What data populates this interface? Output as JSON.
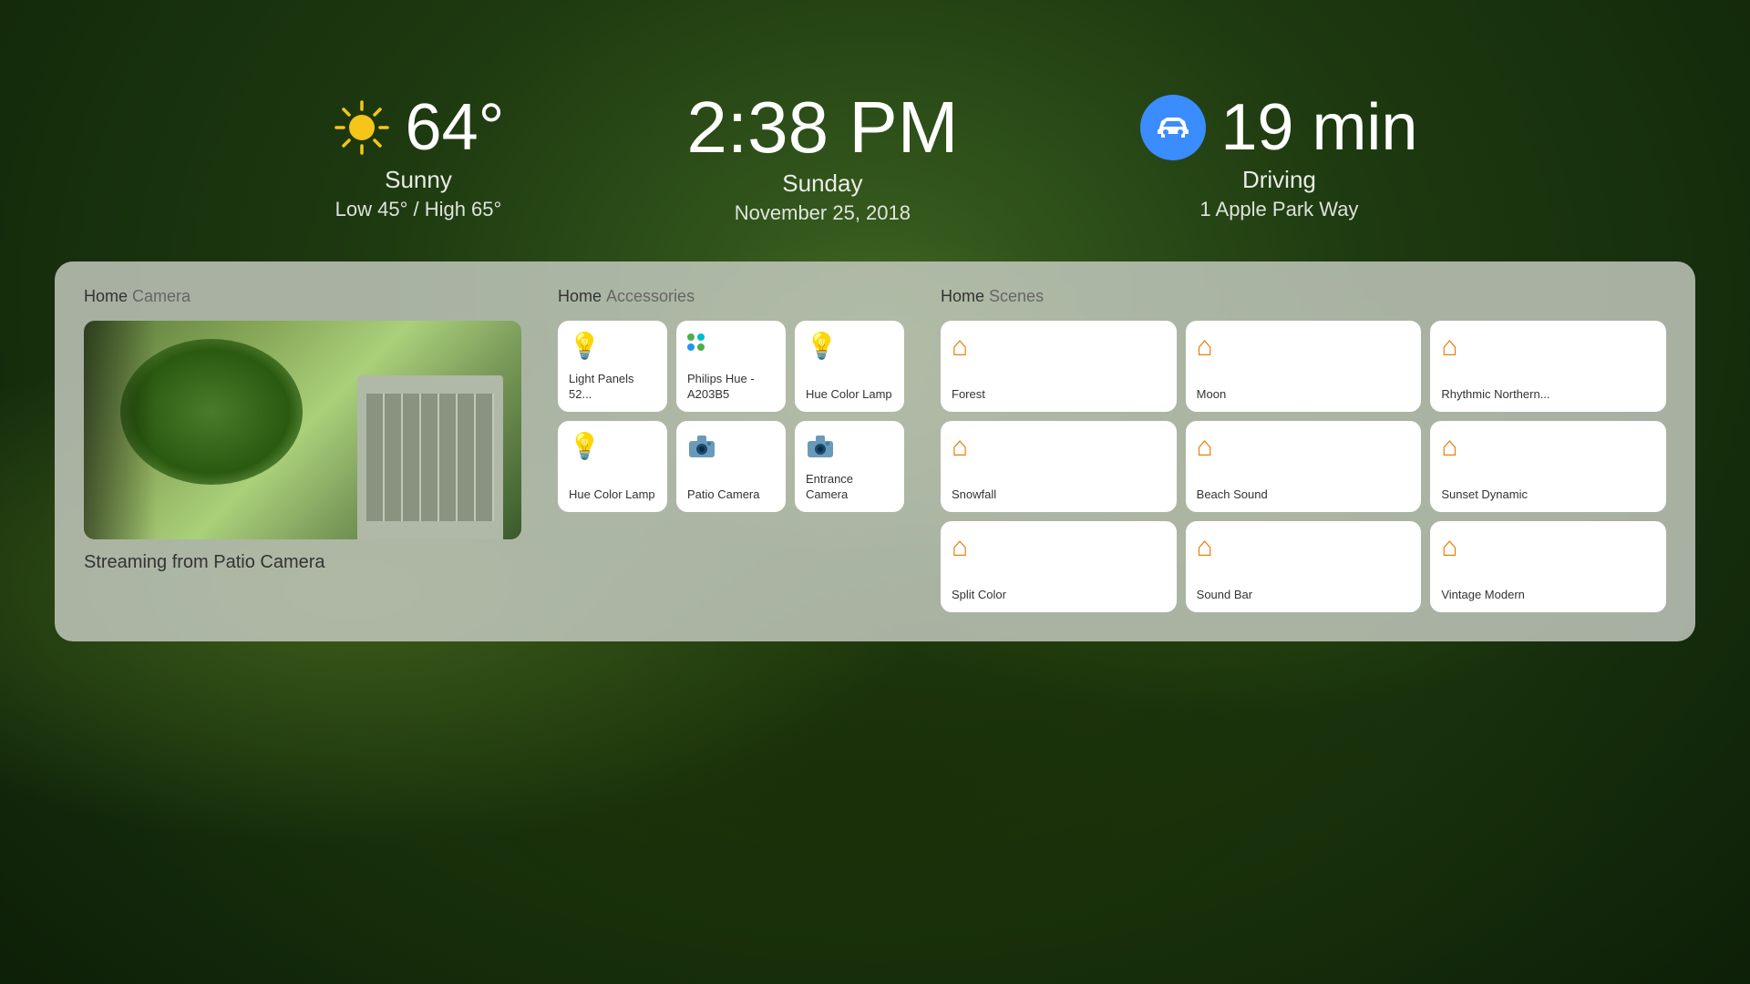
{
  "background": {
    "color": "#2a4a1a"
  },
  "weather": {
    "temperature": "64°",
    "condition": "Sunny",
    "range": "Low 45° / High 65°",
    "icon": "sun-icon"
  },
  "time": {
    "time": "2:38 PM",
    "day": "Sunday",
    "date": "November 25, 2018"
  },
  "maps": {
    "eta": "19 min",
    "mode": "Driving",
    "destination": "1 Apple Park Way",
    "icon": "car-icon"
  },
  "home_panel": {
    "camera_section_title": "Home",
    "camera_section_subtitle": "Camera",
    "camera_label": "Streaming from Patio Camera",
    "accessories_section_title": "Home",
    "accessories_section_subtitle": "Accessories",
    "scenes_section_title": "Home",
    "scenes_section_subtitle": "Scenes",
    "accessories": [
      {
        "id": "light-panels",
        "name": "Light Panels 52...",
        "icon": "💡"
      },
      {
        "id": "philips-hue",
        "name": "Philips Hue - A203B5",
        "icon": "hue"
      },
      {
        "id": "hue-color-lamp-1",
        "name": "Hue Color Lamp",
        "icon": "💡"
      },
      {
        "id": "hue-color-lamp-2",
        "name": "Hue Color Lamp",
        "icon": "💡"
      },
      {
        "id": "patio-camera",
        "name": "Patio Camera",
        "icon": "cam"
      },
      {
        "id": "entrance-camera",
        "name": "Entrance Camera",
        "icon": "cam"
      }
    ],
    "scenes": [
      {
        "id": "forest",
        "name": "Forest"
      },
      {
        "id": "moon",
        "name": "Moon"
      },
      {
        "id": "rhythmic-northern",
        "name": "Rhythmic Northern..."
      },
      {
        "id": "snowfall",
        "name": "Snowfall"
      },
      {
        "id": "beach-sound",
        "name": "Beach Sound"
      },
      {
        "id": "sunset-dynamic",
        "name": "Sunset Dynamic"
      },
      {
        "id": "split-color",
        "name": "Split Color"
      },
      {
        "id": "sound-bar",
        "name": "Sound Bar"
      },
      {
        "id": "vintage-modern",
        "name": "Vintage Modern"
      }
    ]
  }
}
